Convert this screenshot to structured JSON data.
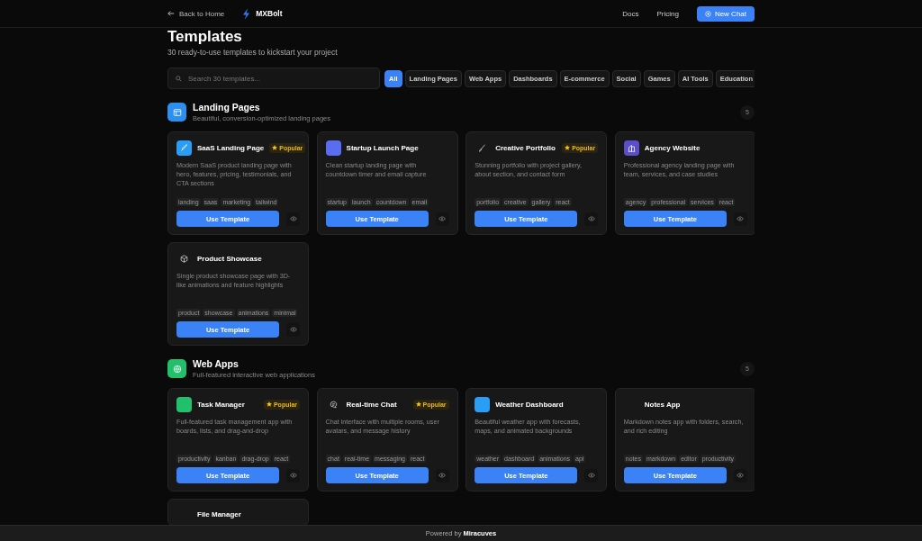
{
  "header": {
    "back_link": "Back to Home",
    "brand": "MXBolt",
    "nav": [
      "Docs",
      "Pricing"
    ],
    "new_chat": "New Chat"
  },
  "title": "Templates",
  "subtitle": "30 ready-to-use templates to kickstart your project",
  "search": {
    "placeholder": "Search 30 templates..."
  },
  "filters": [
    {
      "label": "All",
      "selected": true
    },
    {
      "label": "Landing Pages",
      "selected": false
    },
    {
      "label": "Web Apps",
      "selected": false
    },
    {
      "label": "Dashboards",
      "selected": false
    },
    {
      "label": "E-commerce",
      "selected": false
    },
    {
      "label": "Social",
      "selected": false
    },
    {
      "label": "Games",
      "selected": false
    },
    {
      "label": "AI Tools",
      "selected": false
    },
    {
      "label": "Education",
      "selected": false
    }
  ],
  "sections": [
    {
      "name": "Landing Pages",
      "description": "Beautiful, conversion-optimized landing pages",
      "count": "5",
      "color": "#2d8ff0",
      "templates": [
        {
          "name": "SaaS Landing Page",
          "badge": "Popular",
          "color": "#2a9df4",
          "description": "Modern SaaS product landing page with hero, features, pricing, testimonials, and CTA sections",
          "tags": [
            "landing",
            "saas",
            "marketing",
            "tailwind"
          ],
          "button": "Use Template"
        },
        {
          "name": "Startup Launch Page",
          "color": "#5a6cf0",
          "description": "Clean startup landing page with countdown timer and email capture",
          "tags": [
            "startup",
            "launch",
            "countdown",
            "email"
          ],
          "button": "Use Template"
        },
        {
          "name": "Creative Portfolio",
          "badge": "Popular",
          "description": "Stunning portfolio with project gallery, about section, and contact form",
          "tags": [
            "portfolio",
            "creative",
            "gallery",
            "react"
          ],
          "button": "Use Template"
        },
        {
          "name": "Agency Website",
          "color": "#5b4fc9",
          "description": "Professional agency landing page with team, services, and case studies",
          "tags": [
            "agency",
            "professional",
            "services",
            "react"
          ],
          "button": "Use Template"
        },
        {
          "name": "Product Showcase",
          "description": "Single product showcase page with 3D-like animations and feature highlights",
          "tags": [
            "product",
            "showcase",
            "animations",
            "minimal"
          ],
          "button": "Use Template"
        }
      ]
    },
    {
      "name": "Web Apps",
      "description": "Full-featured interactive web applications",
      "count": "5",
      "color": "#22c06b",
      "templates": [
        {
          "name": "Task Manager",
          "badge": "Popular",
          "color": "#22c06b",
          "description": "Full-featured task management app with boards, lists, and drag-and-drop",
          "tags": [
            "productivity",
            "kanban",
            "drag-drop",
            "react"
          ],
          "button": "Use Template"
        },
        {
          "name": "Real-time Chat",
          "badge": "Popular",
          "description": "Chat interface with multiple rooms, user avatars, and message history",
          "tags": [
            "chat",
            "real-time",
            "messaging",
            "react"
          ],
          "button": "Use Template"
        },
        {
          "name": "Weather Dashboard",
          "color": "#2a9df4",
          "description": "Beautiful weather app with forecasts, maps, and animated backgrounds",
          "tags": [
            "weather",
            "dashboard",
            "animations",
            "api"
          ],
          "button": "Use Template"
        },
        {
          "name": "Notes App",
          "description": "Markdown notes app with folders, search, and rich editing",
          "tags": [
            "notes",
            "markdown",
            "editor",
            "productivity"
          ],
          "button": "Use Template"
        },
        {
          "name": "File Manager"
        }
      ]
    }
  ],
  "footer": {
    "text": "Powered by",
    "brand": "Miracuves"
  }
}
